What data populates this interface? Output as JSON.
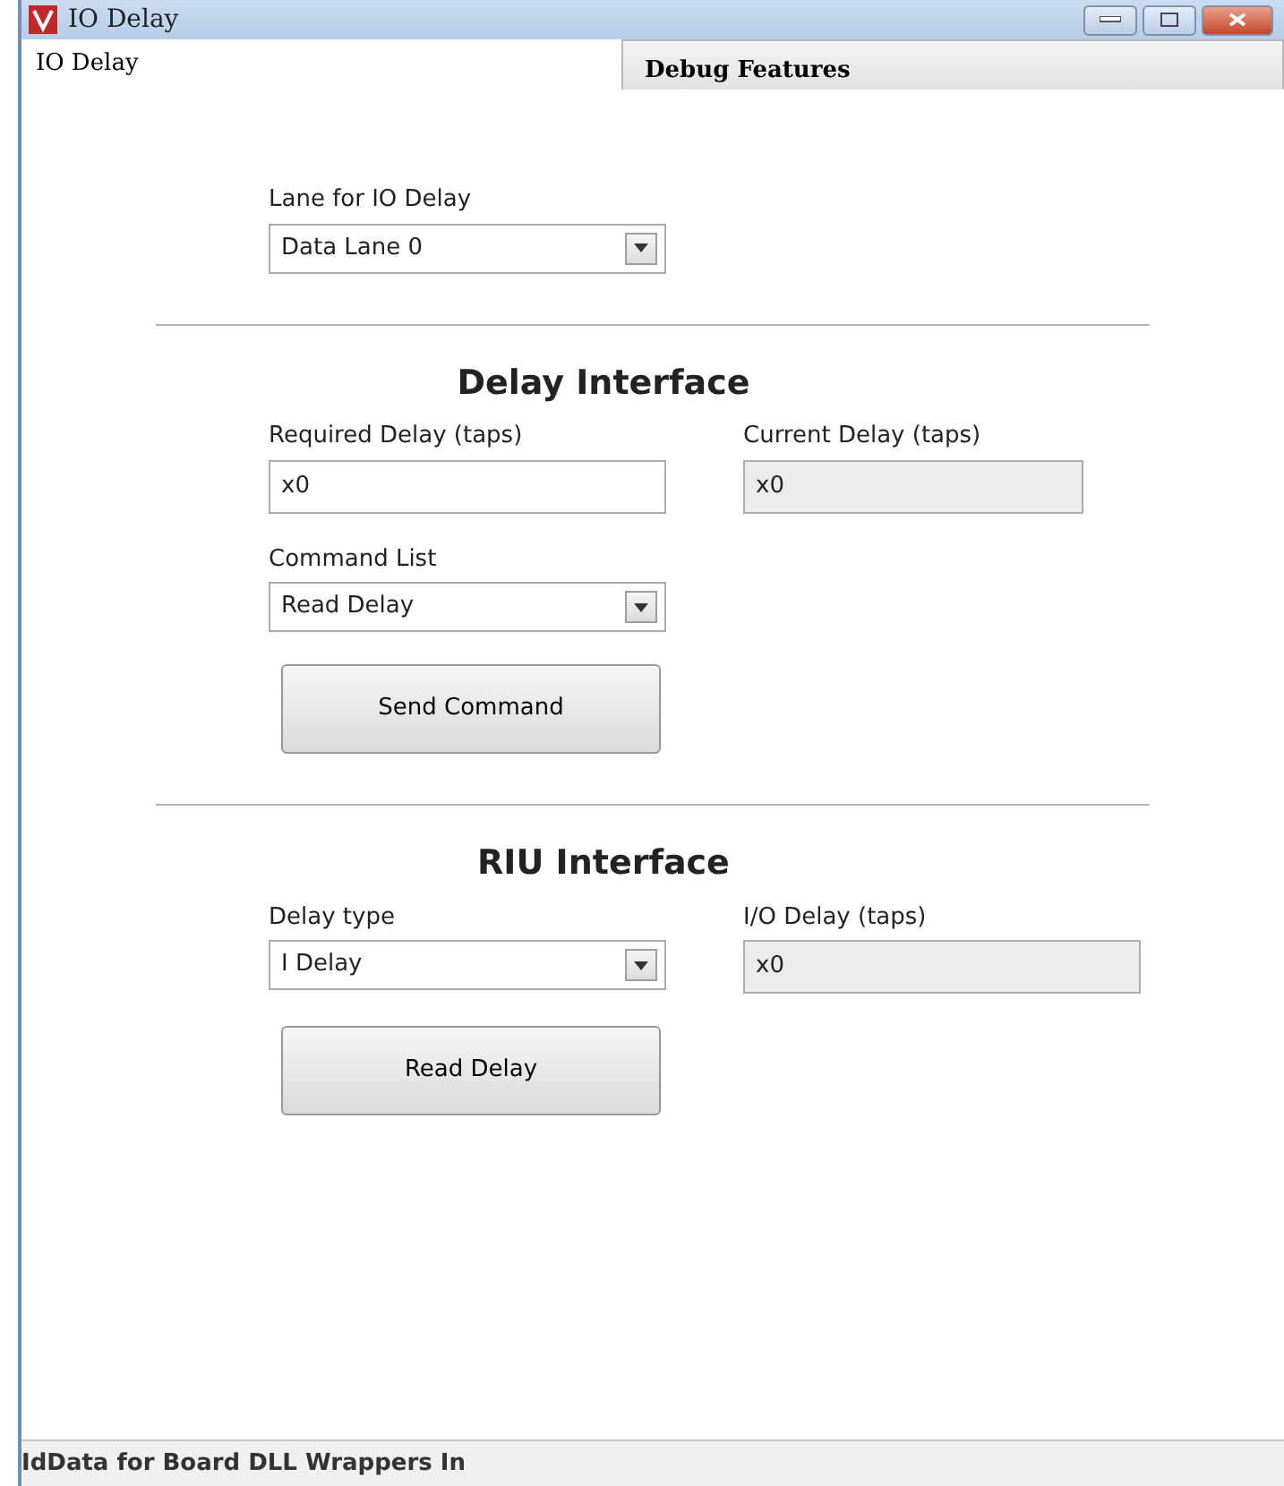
{
  "window": {
    "title": "IO Delay"
  },
  "tabs": [
    {
      "label": "IO Delay",
      "selected": true
    },
    {
      "label": "Debug Features",
      "selected": false
    }
  ],
  "lane": {
    "label": "Lane for IO Delay",
    "value": "Data Lane 0"
  },
  "sections": [
    {
      "title": "Delay Interface",
      "fields": [
        {
          "kind": "input",
          "label": "Required Delay (taps)",
          "value": "x0",
          "disabled": false
        },
        {
          "kind": "input",
          "label": "Current Delay (taps)",
          "value": "x0",
          "disabled": true
        }
      ],
      "command": {
        "label": "Command List",
        "value": "Read Delay"
      },
      "button": "Send Command"
    },
    {
      "title": "RIU Interface",
      "fields": [
        {
          "kind": "select",
          "label": "Delay type",
          "value": "I Delay"
        },
        {
          "kind": "input",
          "label": "I/O Delay (taps)",
          "value": "x0",
          "disabled": true
        }
      ],
      "button": "Read Delay"
    }
  ],
  "status_bar": [
    "Id",
    "Data for Board DLL Wrappers In"
  ]
}
